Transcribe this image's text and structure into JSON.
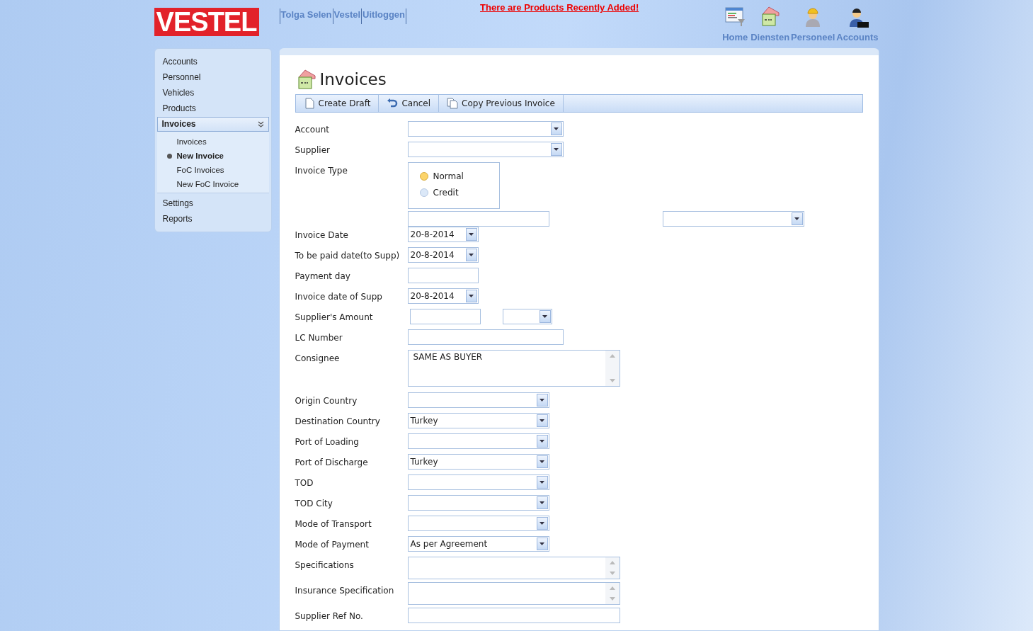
{
  "header": {
    "logo": "VESTEL",
    "user_links": [
      "Tolga Selen",
      "Vestel",
      "Uitloggen"
    ],
    "notice": "There are Products Recently Added!",
    "nav": [
      {
        "label": "Home"
      },
      {
        "label": "Diensten"
      },
      {
        "label": "Personeel"
      },
      {
        "label": "Accounts"
      }
    ]
  },
  "sidebar": {
    "items": [
      {
        "label": "Accounts",
        "selected": false
      },
      {
        "label": "Personnel",
        "selected": false
      },
      {
        "label": "Vehicles",
        "selected": false
      },
      {
        "label": "Products",
        "selected": false
      },
      {
        "label": "Invoices",
        "selected": true,
        "expanded": true,
        "children": [
          {
            "label": "Invoices",
            "selected": false
          },
          {
            "label": "New Invoice",
            "selected": true
          },
          {
            "label": "FoC Invoices",
            "selected": false
          },
          {
            "label": "New FoC Invoice",
            "selected": false
          }
        ]
      },
      {
        "label": "Settings",
        "selected": false
      },
      {
        "label": "Reports",
        "selected": false
      }
    ]
  },
  "page": {
    "title": "Invoices",
    "toolbar": [
      {
        "label": "Create Draft"
      },
      {
        "label": "Cancel"
      },
      {
        "label": "Copy Previous Invoice"
      }
    ],
    "fields": [
      {
        "label": "Account",
        "kind": "combo-wide"
      },
      {
        "label": "Supplier",
        "kind": "combo-wide"
      },
      {
        "label": "Invoice Type",
        "kind": "radio",
        "options": [
          {
            "label": "Normal",
            "selected": true
          },
          {
            "label": "Credit",
            "selected": false
          }
        ]
      },
      {
        "kind": "pair"
      },
      {
        "label": "Invoice Date",
        "kind": "date",
        "value": "20-8-2014"
      },
      {
        "label": "To be paid date(to Supp)",
        "kind": "date",
        "value": "20-8-2014"
      },
      {
        "label": "Payment day",
        "kind": "short-text"
      },
      {
        "label": "Invoice date of Supp",
        "kind": "date",
        "value": "20-8-2014"
      },
      {
        "label": "Supplier's Amount",
        "kind": "amount"
      },
      {
        "label": "LC Number",
        "kind": "text"
      },
      {
        "label": "Consignee",
        "kind": "memo-tall",
        "value": "SAME AS BUYER"
      },
      {
        "label": "Origin Country",
        "kind": "combo"
      },
      {
        "label": "Destination Country",
        "kind": "combo",
        "value": "Turkey"
      },
      {
        "label": "Port of Loading",
        "kind": "combo"
      },
      {
        "label": "Port of Discharge",
        "kind": "combo",
        "value": "Turkey"
      },
      {
        "label": "TOD",
        "kind": "combo"
      },
      {
        "label": "TOD City",
        "kind": "combo"
      },
      {
        "label": "Mode of Transport",
        "kind": "combo"
      },
      {
        "label": "Mode of Payment",
        "kind": "combo",
        "value": "As per Agreement"
      },
      {
        "label": "Specifications",
        "kind": "memo"
      },
      {
        "label": "Insurance Specification",
        "kind": "memo"
      },
      {
        "label": "Supplier Ref No.",
        "kind": "text-wide"
      }
    ]
  }
}
